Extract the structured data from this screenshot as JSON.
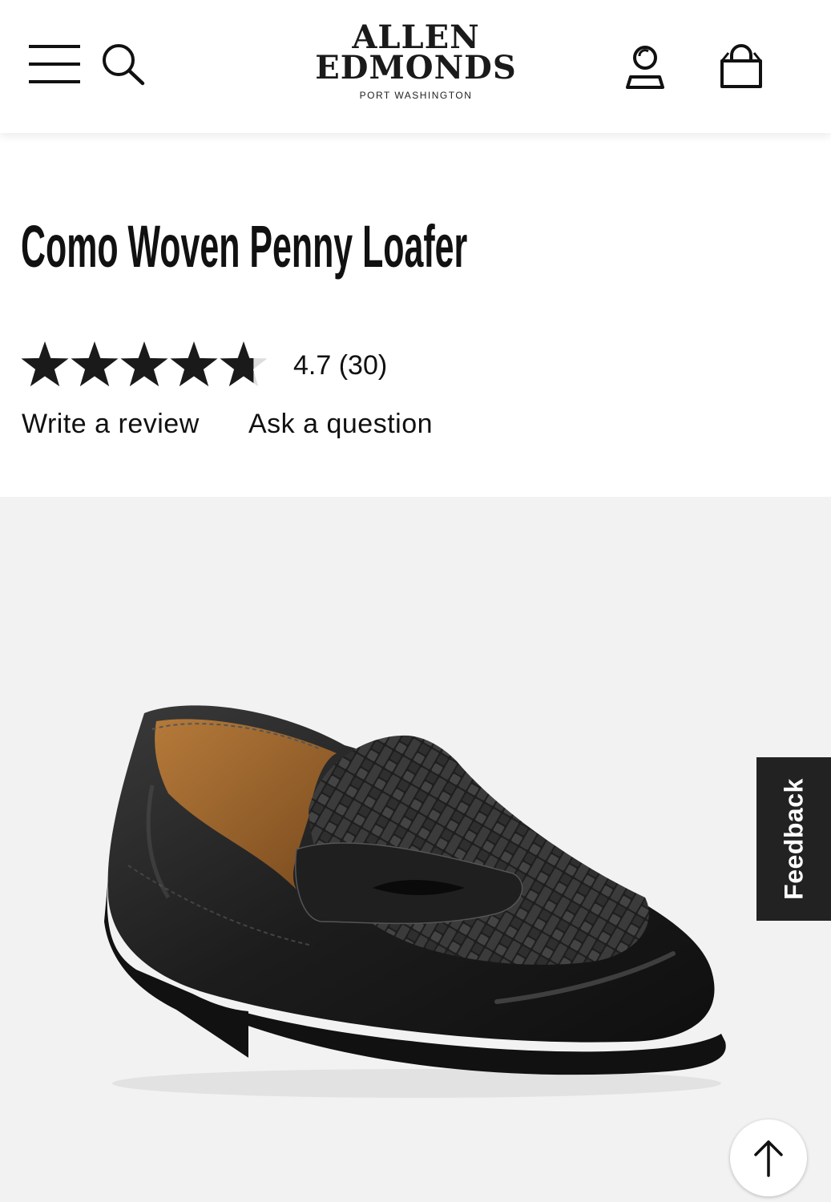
{
  "header": {
    "logo_line1": "ALLEN",
    "logo_line2": "EDMONDS",
    "logo_line3": "PORT WASHINGTON",
    "icons": [
      "menu-icon",
      "search-icon",
      "account-icon",
      "shopping-bag-icon"
    ]
  },
  "product": {
    "title": "Como Woven Penny Loafer",
    "rating_value": 4.7,
    "rating_max": 5,
    "rating_text": "4.7 (30)",
    "write_review_label": "Write a review",
    "ask_question_label": "Ask a question"
  },
  "gallery": {
    "feedback_label": "Feedback",
    "scroll_top_icon": "arrow-up-icon"
  },
  "colors": {
    "text": "#111111",
    "gallery_bg": "#f2f2f2",
    "feedback_bg": "#222222",
    "star": "#1a1a1a",
    "star_empty": "#dddddd"
  }
}
